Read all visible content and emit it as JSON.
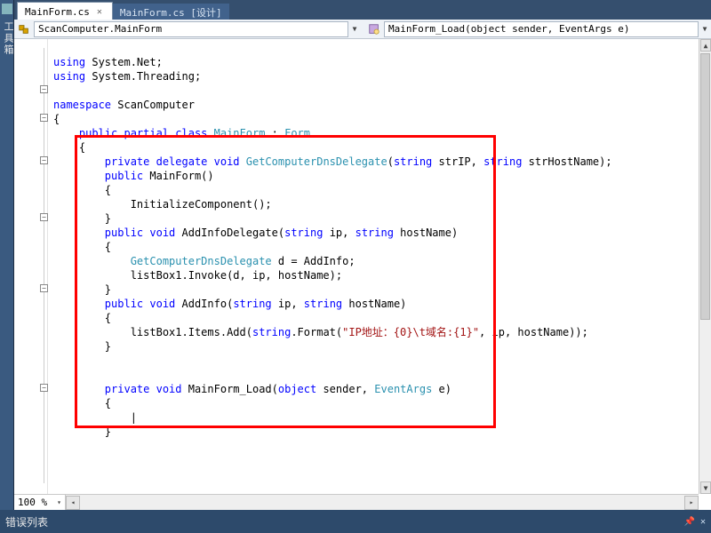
{
  "leftrail": {
    "label": "工具箱"
  },
  "tabs": {
    "active": {
      "label": "MainForm.cs",
      "closable": true
    },
    "inactive": {
      "label": "MainForm.cs [设计]"
    }
  },
  "nav": {
    "left": "ScanComputer.MainForm",
    "right": "MainForm_Load(object sender, EventArgs e)"
  },
  "zoom": "100 %",
  "dock": {
    "title": "错误列表",
    "pin": "📌",
    "close": "✕"
  },
  "code": {
    "l1a": "using",
    "l1b": " System.Net;",
    "l2a": "using",
    "l2b": " System.Threading;",
    "l4a": "namespace",
    "l4b": " ScanComputer",
    "l5": "{",
    "l6a": "    public partial class ",
    "l6b": "MainForm",
    "l6c": " : ",
    "l6d": "Form",
    "l7": "    {",
    "l8a": "        private delegate void ",
    "l8b": "GetComputerDnsDelegate",
    "l8c": "(",
    "l8d": "string",
    "l8e": " strIP, ",
    "l8f": "string",
    "l8g": " strHostName);",
    "l9a": "        public",
    "l9b": " MainForm()",
    "l10": "        {",
    "l11": "            InitializeComponent();",
    "l12": "        }",
    "l13a": "        public void",
    "l13b": " AddInfoDelegate(",
    "l13c": "string",
    "l13d": " ip, ",
    "l13e": "string",
    "l13f": " hostName)",
    "l14": "        {",
    "l15a": "            ",
    "l15b": "GetComputerDnsDelegate",
    "l15c": " d = AddInfo;",
    "l16": "            listBox1.Invoke(d, ip, hostName);",
    "l17": "        }",
    "l18a": "        public void",
    "l18b": " AddInfo(",
    "l18c": "string",
    "l18d": " ip, ",
    "l18e": "string",
    "l18f": " hostName)",
    "l19": "        {",
    "l20a": "            listBox1.Items.Add(",
    "l20b": "string",
    "l20c": ".Format(",
    "l20d": "\"IP地址：{0}\\t域名:{1}\"",
    "l20e": ", ip, hostName));",
    "l21": "        }",
    "l24a": "        private void",
    "l24b": " MainForm_Load(",
    "l24c": "object",
    "l24d": " sender, ",
    "l24e": "EventArgs",
    "l24f": " e)",
    "l25": "        {",
    "l26": "            |",
    "l27": "        }"
  }
}
